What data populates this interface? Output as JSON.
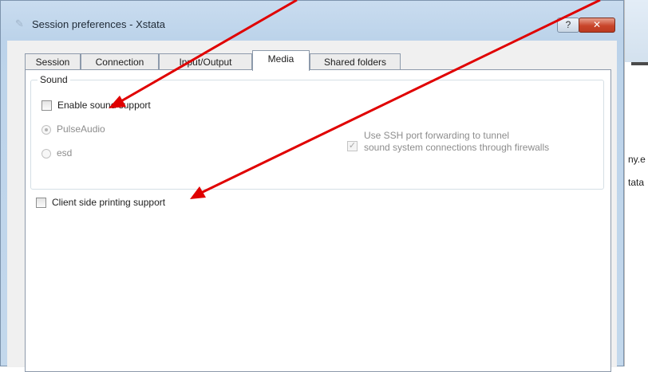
{
  "window": {
    "title": "Session preferences - Xstata",
    "help_label": "?",
    "close_label": "✕"
  },
  "tabs": [
    {
      "label": "Session",
      "active": false
    },
    {
      "label": "Connection",
      "active": false
    },
    {
      "label": "Input/Output",
      "active": false
    },
    {
      "label": "Media",
      "active": true
    },
    {
      "label": "Shared folders",
      "active": false
    }
  ],
  "media": {
    "sound_group_label": "Sound",
    "enable_sound": {
      "label": "Enable sound support",
      "checked": false
    },
    "sound_systems": [
      {
        "label": "PulseAudio",
        "selected": true,
        "enabled": false
      },
      {
        "label": "esd",
        "selected": false,
        "enabled": false
      }
    ],
    "ssh_forwarding": {
      "line1": "Use SSH port forwarding to tunnel",
      "line2": "sound system connections through firewalls",
      "checked": true,
      "enabled": false
    },
    "client_printing": {
      "label": "Client side printing support",
      "checked": false
    }
  },
  "background_window": {
    "fragments": [
      "ny.e",
      "tata"
    ]
  },
  "colors": {
    "annotation_arrow": "#e00000",
    "close_button": "#c9452a"
  }
}
